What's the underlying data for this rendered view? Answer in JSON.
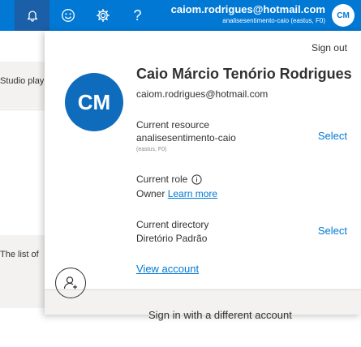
{
  "topbar": {
    "icons": [
      "bell-icon",
      "smiley-icon",
      "gear-icon",
      "help-icon"
    ],
    "help_glyph": "?",
    "email": "caiom.rodrigues@hotmail.com",
    "subtitle": "analisesentimento-caio (eastus, F0)",
    "avatar_initials": "CM",
    "color": "#0078d4"
  },
  "background": {
    "text1": "Studio play",
    "text2": "The list of"
  },
  "account": {
    "sign_out": "Sign out",
    "avatar_initials": "CM",
    "name": "Caio Márcio Tenório Rodrigues",
    "email": "caiom.rodrigues@hotmail.com",
    "resource_label": "Current resource",
    "resource_value": "analisesentimento-caio",
    "resource_meta": "(eastus, F0)",
    "resource_select": "Select",
    "role_label": "Current role",
    "role_value": "Owner",
    "learn_more": "Learn more",
    "directory_label": "Current directory",
    "directory_value": "Diretório Padrão",
    "directory_select": "Select",
    "view_account": "View account",
    "different_account": "Sign in with a different account"
  }
}
